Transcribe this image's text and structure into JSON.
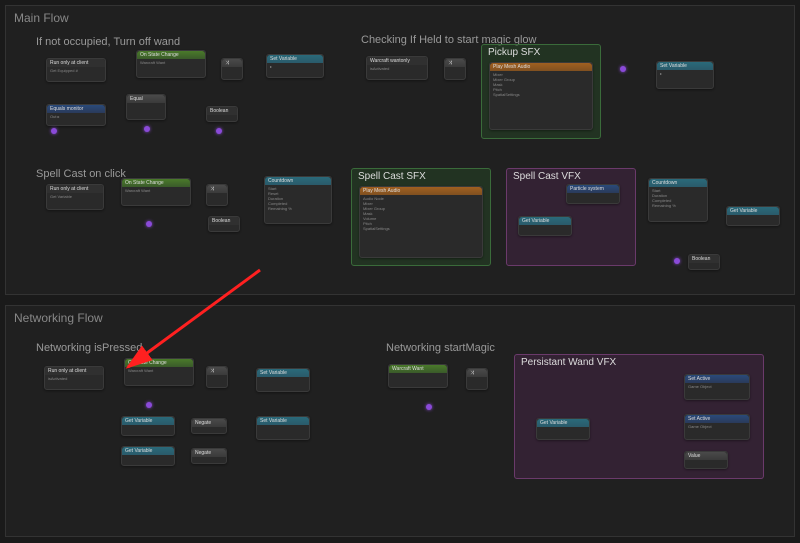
{
  "panels": {
    "main": {
      "title": "Main Flow"
    },
    "net": {
      "title": "Networking Flow"
    }
  },
  "sections": {
    "s1": "If not occupied, Turn off wand",
    "s2": "Checking If Held to start magic glow",
    "s3": "Spell Cast on click",
    "s4": "Networking isPressed",
    "s5": "Networking startMagic"
  },
  "groups": {
    "pickup_sfx": "Pickup SFX",
    "spell_sfx": "Spell Cast SFX",
    "spell_vfx": "Spell Cast VFX",
    "pwand_vfx": "Persistant Wand VFX"
  },
  "nodes": {
    "onEquipped": {
      "title": "Get Equipped #",
      "sub": ""
    },
    "equalsMonitor": {
      "title": "Equals monitor",
      "sub": ""
    },
    "onStateChange1": {
      "title": "On State Change",
      "sub": "Warcraft Want"
    },
    "equal": {
      "title": "Equal",
      "sub": ""
    },
    "branch1": {
      "title": "",
      "sub": ""
    },
    "boolean1": {
      "title": "Boolean",
      "sub": ""
    },
    "setVar1": {
      "title": "Set Variable",
      "sub": ""
    },
    "eventHeld": {
      "title": "Warcraft wantonly",
      "sub": "isActivated"
    },
    "branch2": {
      "title": "",
      "sub": ""
    },
    "playAudio1": {
      "title": "Play Mesh Audio",
      "sub": "Warcraft Want"
    },
    "audioPins1": [
      "Mixer",
      "Mixer Group",
      "Mask",
      "Pitch",
      "SpatialSettings"
    ],
    "setVar2": {
      "title": "Set Variable",
      "sub": ""
    },
    "boolPill": "Boolean",
    "spellClick": {
      "title": "Spell Cast on click",
      "sub": ""
    },
    "getVar1": {
      "title": "Get Variable",
      "sub": ""
    },
    "onStateChange2": {
      "title": "On State Change",
      "sub": "Warcraft Want"
    },
    "branch3": {
      "title": "",
      "sub": ""
    },
    "countdown1": {
      "title": "Countdown",
      "sub": ""
    },
    "countdownPins1": [
      "Start",
      "Reset",
      "Duration",
      "Completed",
      "Remaining %"
    ],
    "playAudio2": {
      "title": "Play Mesh Audio",
      "sub": "Warcraft Want"
    },
    "audioPins2": [
      "Audio Node",
      "Mixer",
      "Mixer Group",
      "Mask",
      "Volume",
      "Pitch",
      "SpatialSettings"
    ],
    "particles": {
      "title": "Particle system",
      "sub": ""
    },
    "getVar2": {
      "title": "Get Variable",
      "sub": ""
    },
    "countdown2": {
      "title": "Countdown",
      "sub": ""
    },
    "countdownPins2": [
      "Start",
      "Duration",
      "Completed",
      "Remaining %"
    ],
    "getVar3": {
      "title": "Get Variable",
      "sub": ""
    },
    "boolPill2": "Boolean",
    "netEvent": {
      "title": "isActivated",
      "sub": ""
    },
    "onStateChange3": {
      "title": "On State Change",
      "sub": "Warcraft Want"
    },
    "branch4": {
      "title": "",
      "sub": ""
    },
    "getVar4": {
      "title": "Get Variable",
      "sub": ""
    },
    "getVar5": {
      "title": "Get Variable",
      "sub": ""
    },
    "negate1": {
      "title": "Negate",
      "sub": ""
    },
    "negate2": {
      "title": "Negate",
      "sub": ""
    },
    "setVar3": {
      "title": "Set Variable",
      "sub": ""
    },
    "setVar4": {
      "title": "Set Variable",
      "sub": ""
    },
    "netEvent2": {
      "title": "Warcraft Want",
      "sub": ""
    },
    "branch5": {
      "title": "",
      "sub": ""
    },
    "getVar6": {
      "title": "Get Variable",
      "sub": ""
    },
    "setActive1": {
      "title": "Set Active",
      "sub": "Game Object"
    },
    "setActive2": {
      "title": "Set Active",
      "sub": "Game Object"
    },
    "valueNode": {
      "title": "Value",
      "sub": ""
    }
  },
  "annotations": {
    "arrow": "red-arrow"
  }
}
